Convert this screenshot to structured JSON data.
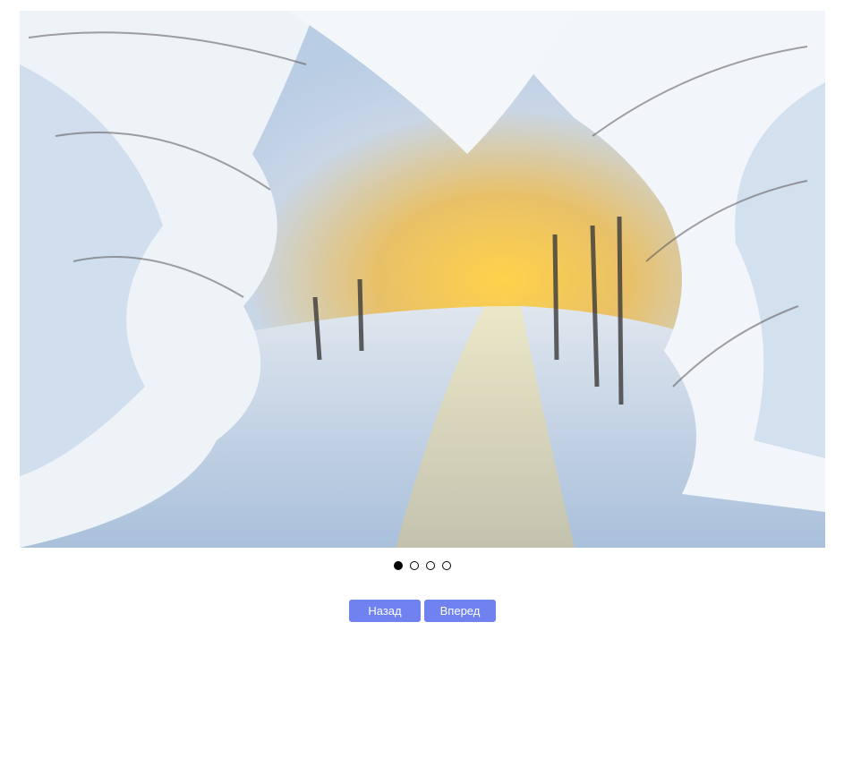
{
  "slider": {
    "current_slide": 1,
    "total_slides": 4,
    "slide_image": "snowy-forest-path-sunrise",
    "dots": [
      {
        "active": true
      },
      {
        "active": false
      },
      {
        "active": false
      },
      {
        "active": false
      }
    ]
  },
  "controls": {
    "prev_label": "Назад",
    "next_label": "Вперед",
    "button_color": "#6f82f0"
  }
}
